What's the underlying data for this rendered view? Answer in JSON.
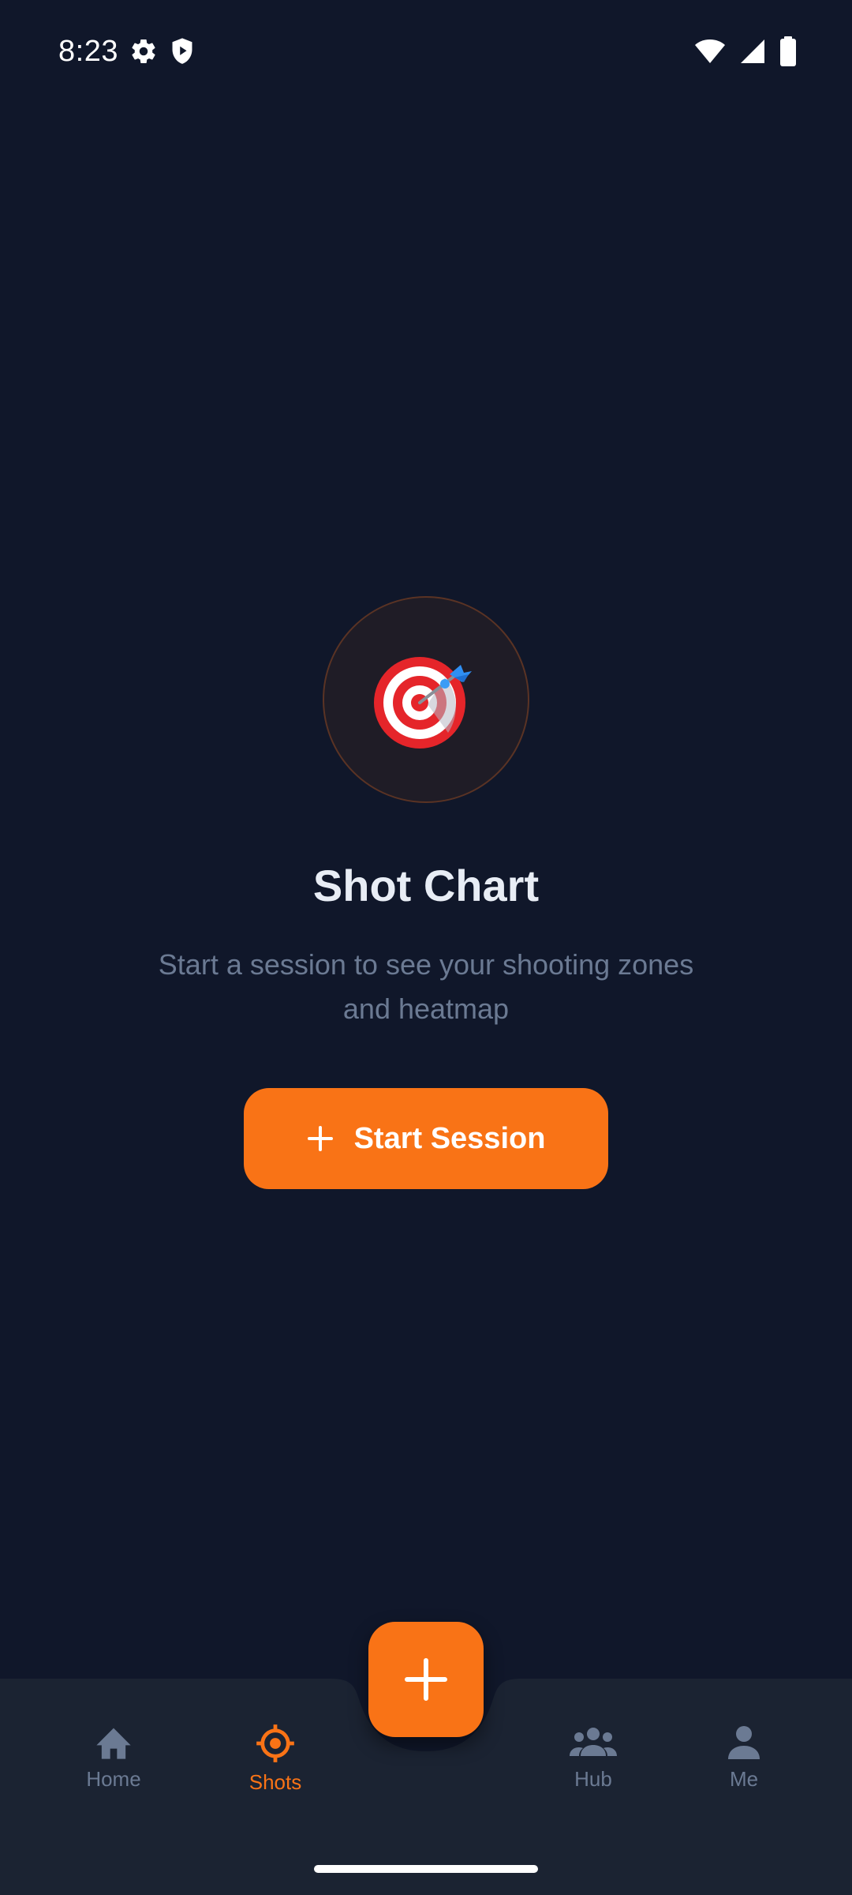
{
  "status_bar": {
    "time": "8:23",
    "icons": [
      "gear-icon",
      "shield-icon",
      "wifi-icon",
      "signal-icon",
      "battery-icon"
    ]
  },
  "empty_state": {
    "icon": "dart-target-icon",
    "title": "Shot Chart",
    "subtitle": "Start a session to see your shooting zones and heatmap",
    "button_label": "Start Session"
  },
  "bottom_nav": {
    "items": [
      {
        "label": "Home",
        "icon": "home-icon",
        "active": false
      },
      {
        "label": "Shots",
        "icon": "crosshair-icon",
        "active": true
      },
      {
        "label": "Hub",
        "icon": "group-icon",
        "active": false
      },
      {
        "label": "Me",
        "icon": "person-icon",
        "active": false
      }
    ],
    "fab_icon": "plus-icon"
  },
  "colors": {
    "background": "#10172a",
    "nav_background": "#1b2332",
    "accent": "#f97316",
    "muted_text": "#6b7a93"
  }
}
